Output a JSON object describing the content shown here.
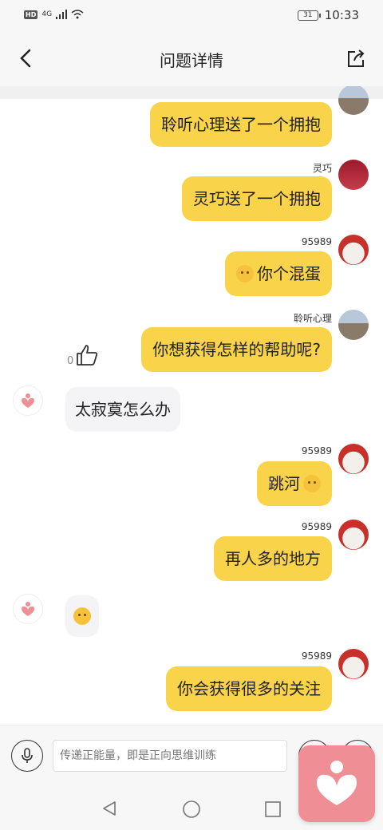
{
  "status_bar": {
    "hd": "HD",
    "network": "4G",
    "battery": "31",
    "time": "10:33"
  },
  "nav": {
    "title": "问题详情"
  },
  "messages": [
    {
      "side": "right",
      "sender": "",
      "text": "聆听心理送了一个拥抱",
      "avatar": "park-avatar"
    },
    {
      "side": "right",
      "sender": "灵巧",
      "text": "灵巧送了一个拥抱",
      "avatar": "person-avatar"
    },
    {
      "side": "right",
      "sender": "95989",
      "text": "你个混蛋",
      "avatar": "cat-avatar",
      "emoji": "pouting-face-emoji"
    },
    {
      "side": "right",
      "sender": "聆听心理",
      "text": "你想获得怎样的帮助呢?",
      "avatar": "park-avatar",
      "likes": "0"
    },
    {
      "side": "left",
      "text": "太寂寞怎么办",
      "avatar": "heart-avatar"
    },
    {
      "side": "right",
      "sender": "95989",
      "text": "跳河",
      "avatar": "cat-avatar",
      "emoji": "pouting-face-emoji"
    },
    {
      "side": "right",
      "sender": "95989",
      "text": "再人多的地方",
      "avatar": "cat-avatar"
    },
    {
      "side": "left",
      "text": "",
      "avatar": "heart-avatar",
      "emoji": "thinking-face-emoji"
    },
    {
      "side": "right",
      "sender": "95989",
      "text": "你会获得很多的关注",
      "avatar": "cat-avatar"
    }
  ],
  "input": {
    "placeholder": "传递正能量，即是正向思维训练"
  },
  "colors": {
    "bubble_self": "#f9d34a",
    "bubble_other": "#f4f4f6",
    "heart_pink": "#ef8f95"
  }
}
